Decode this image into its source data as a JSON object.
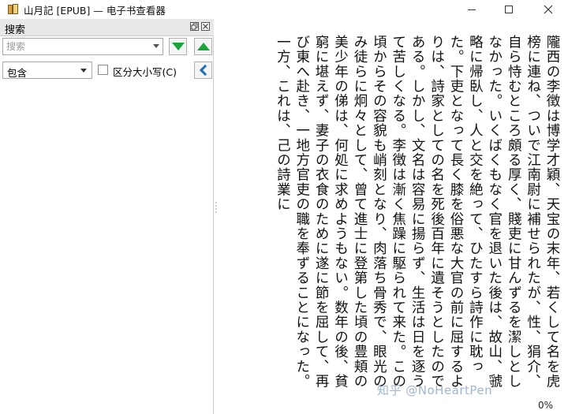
{
  "window": {
    "title": "山月記 [EPUB] — 电子书查看器",
    "app_icon": "book-icon"
  },
  "search_panel": {
    "title": "搜索",
    "search_placeholder": "搜索",
    "mode_value": "包含",
    "case_sensitive_label": "区分大小写(C)",
    "case_sensitive_checked": false,
    "next_icon": "green-down-triangle",
    "prev_icon": "green-up-triangle",
    "collapse_icon": "blue-chevron-left"
  },
  "reader": {
    "text": "隴西の李徴は博学才穎、天宝の末年、若くして名を虎榜に連ね、ついで江南尉に補せられたが、性、狷介、自ら恃むところ頗る厚く、賤吏に甘んずるを潔しとしなかった。いくばくもなく官を退いた後は、故山、虢略に帰臥し、人と交を絶って、ひたすら詩作に耽った。下吏となって長く膝を俗悪な大官の前に屈するよりは、詩家としての名を死後百年に遺そうとしたのである。しかし、文名は容易に揚らず、生活は日を逐うて苦しくなる。李徴は漸く焦躁に駆られて来た。この頃からその容貌も峭刻となり、肉落ち骨秀で、眼光のみ徒らに炯々として、曾て進士に登第した頃の豊頬の美少年の俤は、何処に求めようもない。数年の後、貧窮に堪えず、妻子の衣食のために遂に節を屈して、再び東へ赴き、一地方官吏の職を奉ずることになった。一方、これは、己の詩業に",
    "progress": "0%",
    "watermark": "知乎 @NoHeartPen"
  }
}
